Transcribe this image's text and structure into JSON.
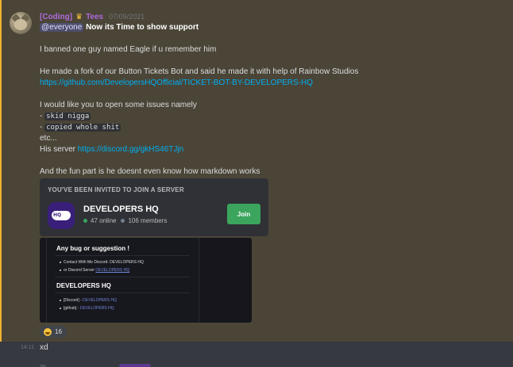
{
  "message": {
    "author_name": "[Coding]",
    "crown_icon": "crown-icon",
    "author_suffix": "Tees",
    "timestamp": "07/09/2021",
    "mention": "@everyone",
    "headline": "Now its Time to show support",
    "line_banned": "I banned one guy named Eagle if u remember him",
    "line_fork": "He made a fork of our Button Tickets Bot and said he made it with help of Rainbow Studios",
    "repo_link": "https://github.com/DevelopersHQOfficial/TICKET-BOT-BY-DEVELOPERS-HQ",
    "line_issues": "I would like you to open some issues namely",
    "issue1_prefix": "- ",
    "issue1_code": "skid nigga",
    "issue2_prefix": "- ",
    "issue2_code": "copied whole shit",
    "etc": "etc...",
    "server_prefix": "His server ",
    "server_link": "https://discord.gg/gkHS46TJjn",
    "line_fun": "And the fun part is he doesnt even know how markdown works"
  },
  "invite": {
    "title": "YOU'VE BEEN INVITED TO JOIN A SERVER",
    "icon_text": "HQ",
    "server_name": "DEVELOPERS HQ",
    "online": "47 online",
    "members": "106 members",
    "join_label": "Join",
    "colors": {
      "join": "#3ba55d",
      "online_dot": "#3ba55d"
    }
  },
  "embed_image": {
    "heading1": "Any bug or suggestion !",
    "item1": "Contact With Me Discord: DEVELOPERS HQ",
    "item2_prefix": "or Discord Server ",
    "item2_link": "DEVELOPERS HQ",
    "heading2": "DEVELOPERS HQ",
    "item3_prefix": "[Discord] - ",
    "item3_link": "DEVELOPERS HQ",
    "item4_prefix": "[github] - ",
    "item4_link": "DEVELOPERS HQ"
  },
  "reaction": {
    "emoji": "laughing-emoji",
    "count": "16"
  },
  "next_message": {
    "time": "14:11",
    "text": "xd"
  },
  "colors": {
    "highlight_bg": "#4a4537",
    "highlight_border": "#f0b232",
    "link": "#00aff4",
    "username": "#b06ad9"
  }
}
